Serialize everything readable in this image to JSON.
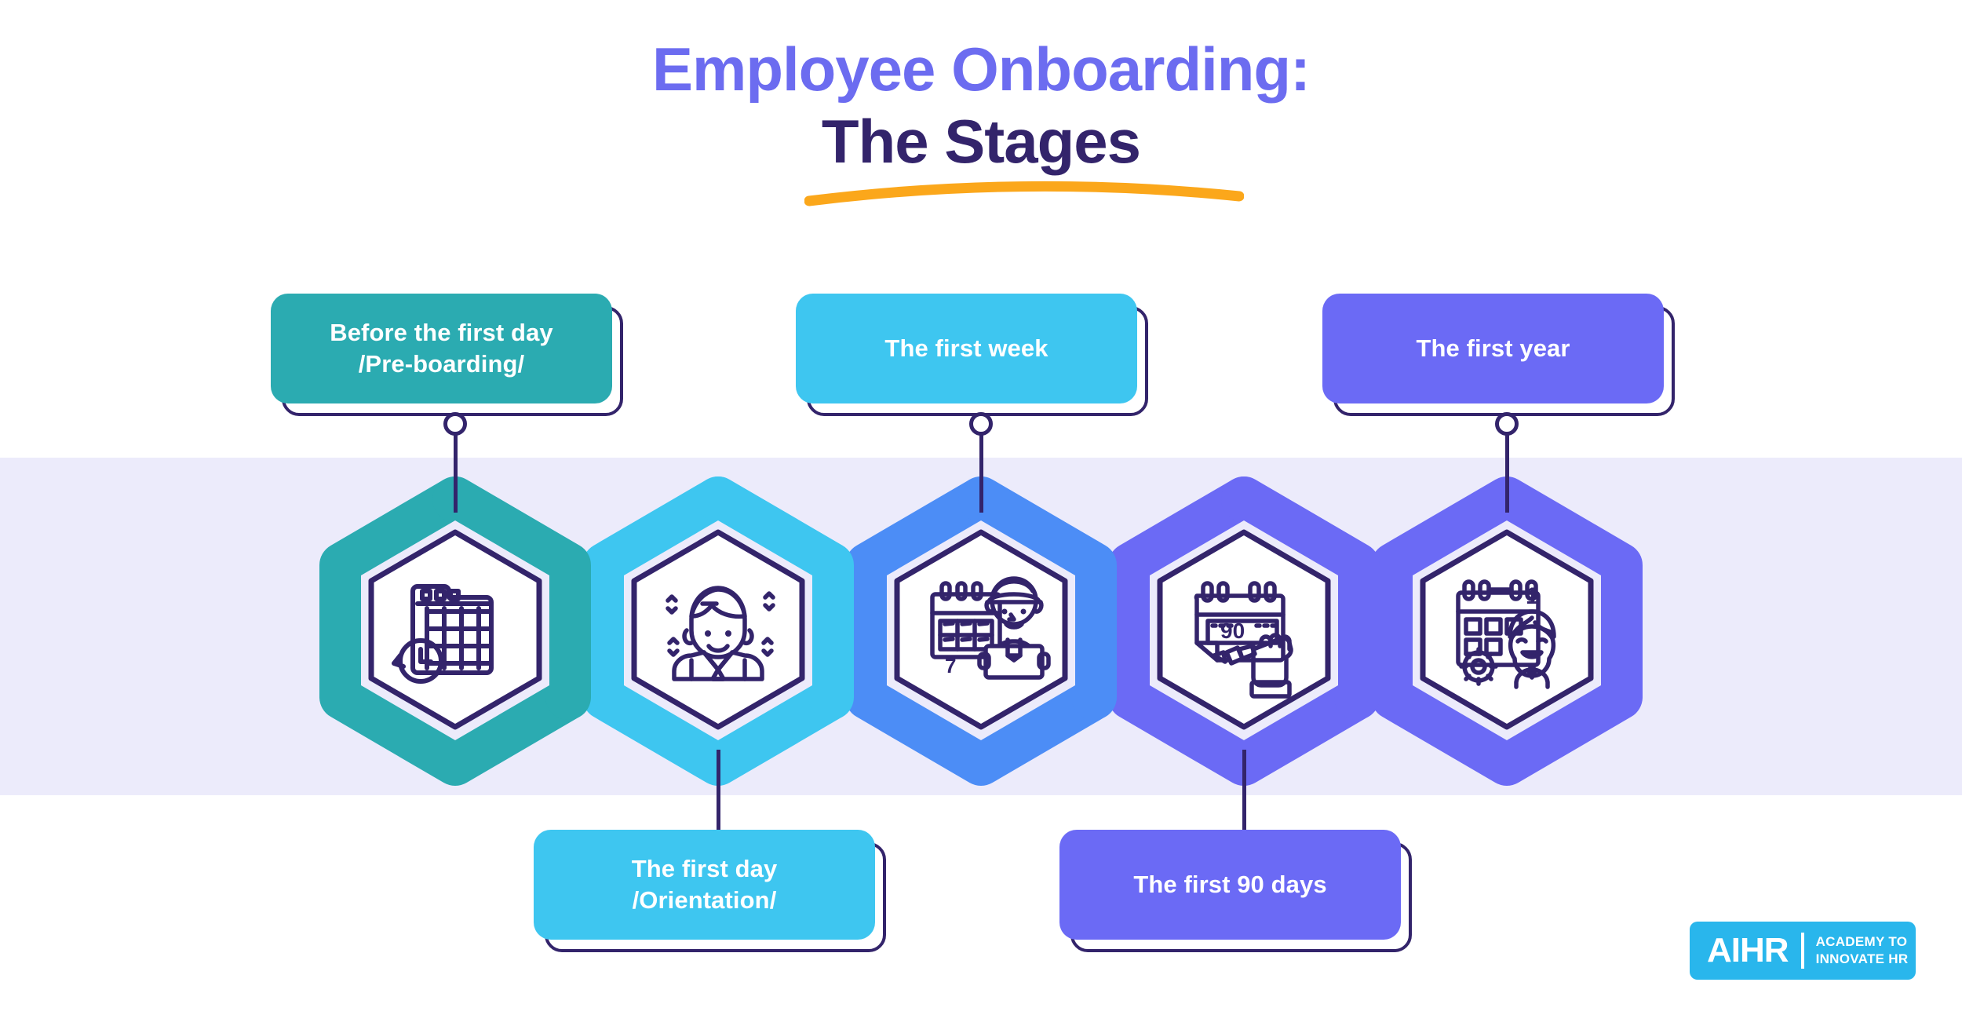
{
  "title": {
    "line1": "Employee Onboarding:",
    "line2": "The Stages",
    "line1_color": "#6C6CF0",
    "line2_color": "#33246B",
    "underline_color": "#FBA71B"
  },
  "theme": {
    "band_background": "#ECEBFB",
    "page_background": "#FFFFFF",
    "outline": "#33246B"
  },
  "stages": [
    {
      "id": "pre-boarding",
      "label_lines": [
        "Before the first day",
        "/Pre-boarding/"
      ],
      "label_position": "top",
      "color": "#2BABB1",
      "icon": "calendar-clock-icon",
      "icon_caption": ""
    },
    {
      "id": "first-day",
      "label_lines": [
        "The first day",
        "/Orientation/"
      ],
      "label_position": "bottom",
      "color": "#3EC6F0",
      "icon": "smiling-employee-icon",
      "icon_caption": ""
    },
    {
      "id": "first-week",
      "label_lines": [
        "The first week"
      ],
      "label_position": "top",
      "color": "#4C8DF6",
      "icon": "calendar-worker-icon",
      "icon_caption": "7"
    },
    {
      "id": "first-90-days",
      "label_lines": [
        "The first 90 days"
      ],
      "label_position": "bottom",
      "color": "#6B6AF5",
      "icon": "calendar-hand-pencil-icon",
      "icon_caption": "90"
    },
    {
      "id": "first-year",
      "label_lines": [
        "The first year"
      ],
      "label_position": "top",
      "color": "#6B6AF5",
      "icon": "calendar-gear-person-icon",
      "icon_caption": "1"
    }
  ],
  "hex_ring_colors": [
    "#2BABB1",
    "#3EC6F0",
    "#4C8DF6",
    "#6B6AF5",
    "#6B6AF5"
  ],
  "logo": {
    "mark": "AIHR",
    "tagline_line1": "ACADEMY TO",
    "tagline_line2": "INNOVATE HR",
    "background": "#29B6EC"
  }
}
